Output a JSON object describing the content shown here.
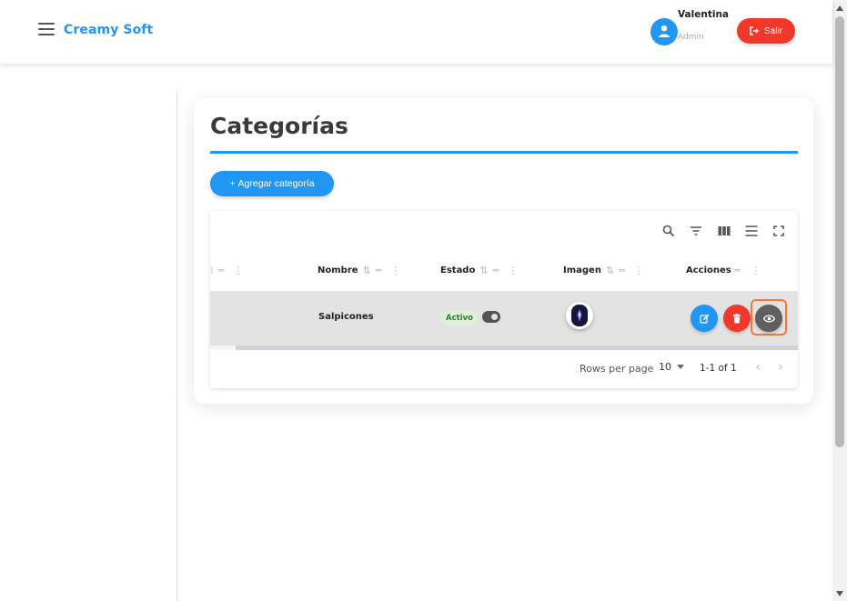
{
  "header": {
    "brand": "Creamy Soft",
    "user_name": "Valentina",
    "user_role": "Admin",
    "logout_label": "Salir",
    "accent_color": "#2196f3",
    "danger_color": "#f2382a"
  },
  "page": {
    "title": "Categorías",
    "add_button_label": "Agregar categoría",
    "add_button_icon": "+"
  },
  "toolbar_icons": [
    "search-icon",
    "filter-icon",
    "columns-icon",
    "density-icon",
    "fullscreen-icon"
  ],
  "table": {
    "columns": [
      "Nombre",
      "Estado",
      "Imagen",
      "Acciones"
    ],
    "rows": [
      {
        "nombre": "Salpicones",
        "estado": "Activo",
        "estado_toggle_on": true,
        "actions": [
          "edit-icon",
          "delete-icon",
          "eye-icon"
        ]
      }
    ],
    "footer": {
      "rows_per_page_label": "Rows per page",
      "rows_per_page_value": "10",
      "range_label": "1-1 of 1"
    }
  }
}
